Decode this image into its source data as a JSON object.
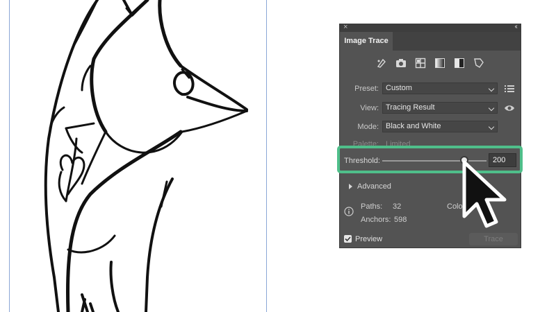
{
  "panel": {
    "tab_label": "Image Trace",
    "close_glyph": "×",
    "collapse_glyph": "‹‹",
    "preset_icons": [
      "auto-color-icon",
      "high-color-icon",
      "low-color-icon",
      "grayscale-icon",
      "black-and-white-icon",
      "outline-icon"
    ],
    "preset": {
      "label": "Preset:",
      "value": "Custom"
    },
    "view": {
      "label": "View:",
      "value": "Tracing Result"
    },
    "mode": {
      "label": "Mode:",
      "value": "Black and White"
    },
    "palette": {
      "label": "Palette:",
      "value": "Limited"
    },
    "threshold": {
      "label": "Threshold:",
      "value": "200",
      "min": 0,
      "max": 255,
      "current": 200
    },
    "advanced_label": "Advanced",
    "stats": {
      "paths_label": "Paths:",
      "paths_value": "32",
      "anchors_label": "Anchors:",
      "anchors_value": "598",
      "colors_label": "Colo"
    },
    "preview_label": "Preview",
    "preview_checked": true,
    "trace_label": "Trace"
  },
  "colors": {
    "panel_bg": "#535353",
    "highlight": "#4fbf8a",
    "artboard_edge": "#8aa6d6"
  }
}
